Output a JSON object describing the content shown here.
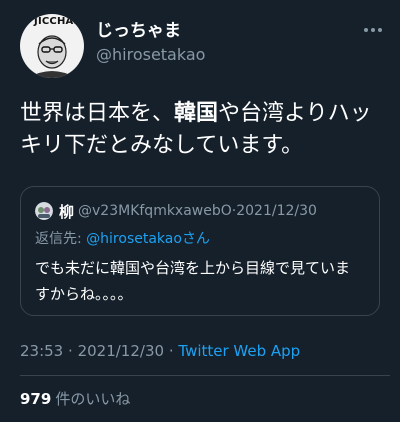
{
  "tweet": {
    "author": {
      "display_name": "じっちゃま",
      "handle": "@hirosetakao",
      "avatar_banner": "G JICCHAN"
    },
    "text_parts": {
      "before": "世界は日本を、",
      "bold": "韓国",
      "after": "や台湾よりハッキリ下だとみなしています。"
    },
    "time": "23:53",
    "date": "2021/12/30",
    "source": "Twitter Web App",
    "separator": "·",
    "likes": {
      "count": "979",
      "label": "件のいいね"
    }
  },
  "quote": {
    "author_name": "柳",
    "handle": "@v23MKfqmkxawebO",
    "separator": "·",
    "date": "2021/12/30",
    "reply_label": "返信先:",
    "reply_mention": "@hirosetakao",
    "reply_suffix": "さん",
    "body": "でも未だに韓国や台湾を上から目線で見ていますからね。。。。"
  },
  "icons": {
    "more": "more-horizontal-icon"
  },
  "colors": {
    "background": "#15202b",
    "text": "#ffffff",
    "secondary": "#8899a6",
    "link": "#1da1f2",
    "border": "#38444d"
  }
}
